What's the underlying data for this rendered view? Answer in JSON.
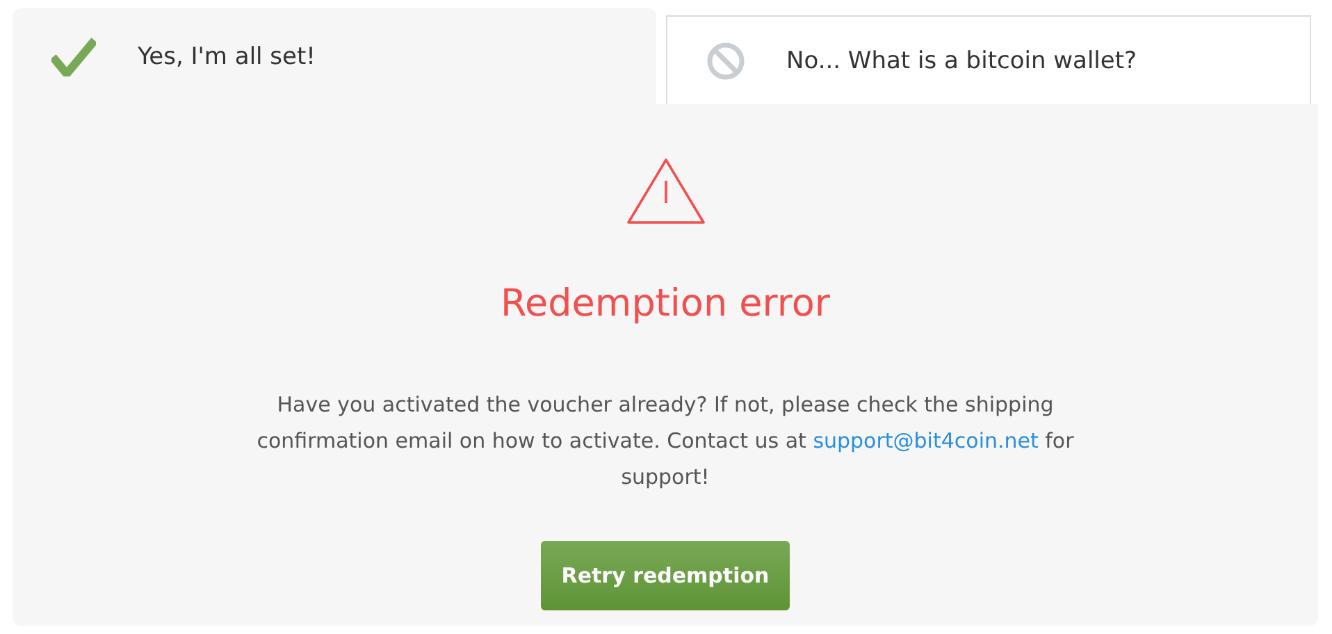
{
  "tabs": [
    {
      "label": "Yes, I'm all set!",
      "kind": "check",
      "selected": true
    },
    {
      "label": "No... What is a bitcoin wallet?",
      "kind": "block",
      "selected": false
    }
  ],
  "error": {
    "title": "Redemption error",
    "message": {
      "before": "Have you activated the voucher already? If not, please check the shipping confirmation email on how to activate. Contact us at ",
      "link": "support@bit4coin.net",
      "after": " for support!"
    },
    "button": "Retry redemption"
  }
}
